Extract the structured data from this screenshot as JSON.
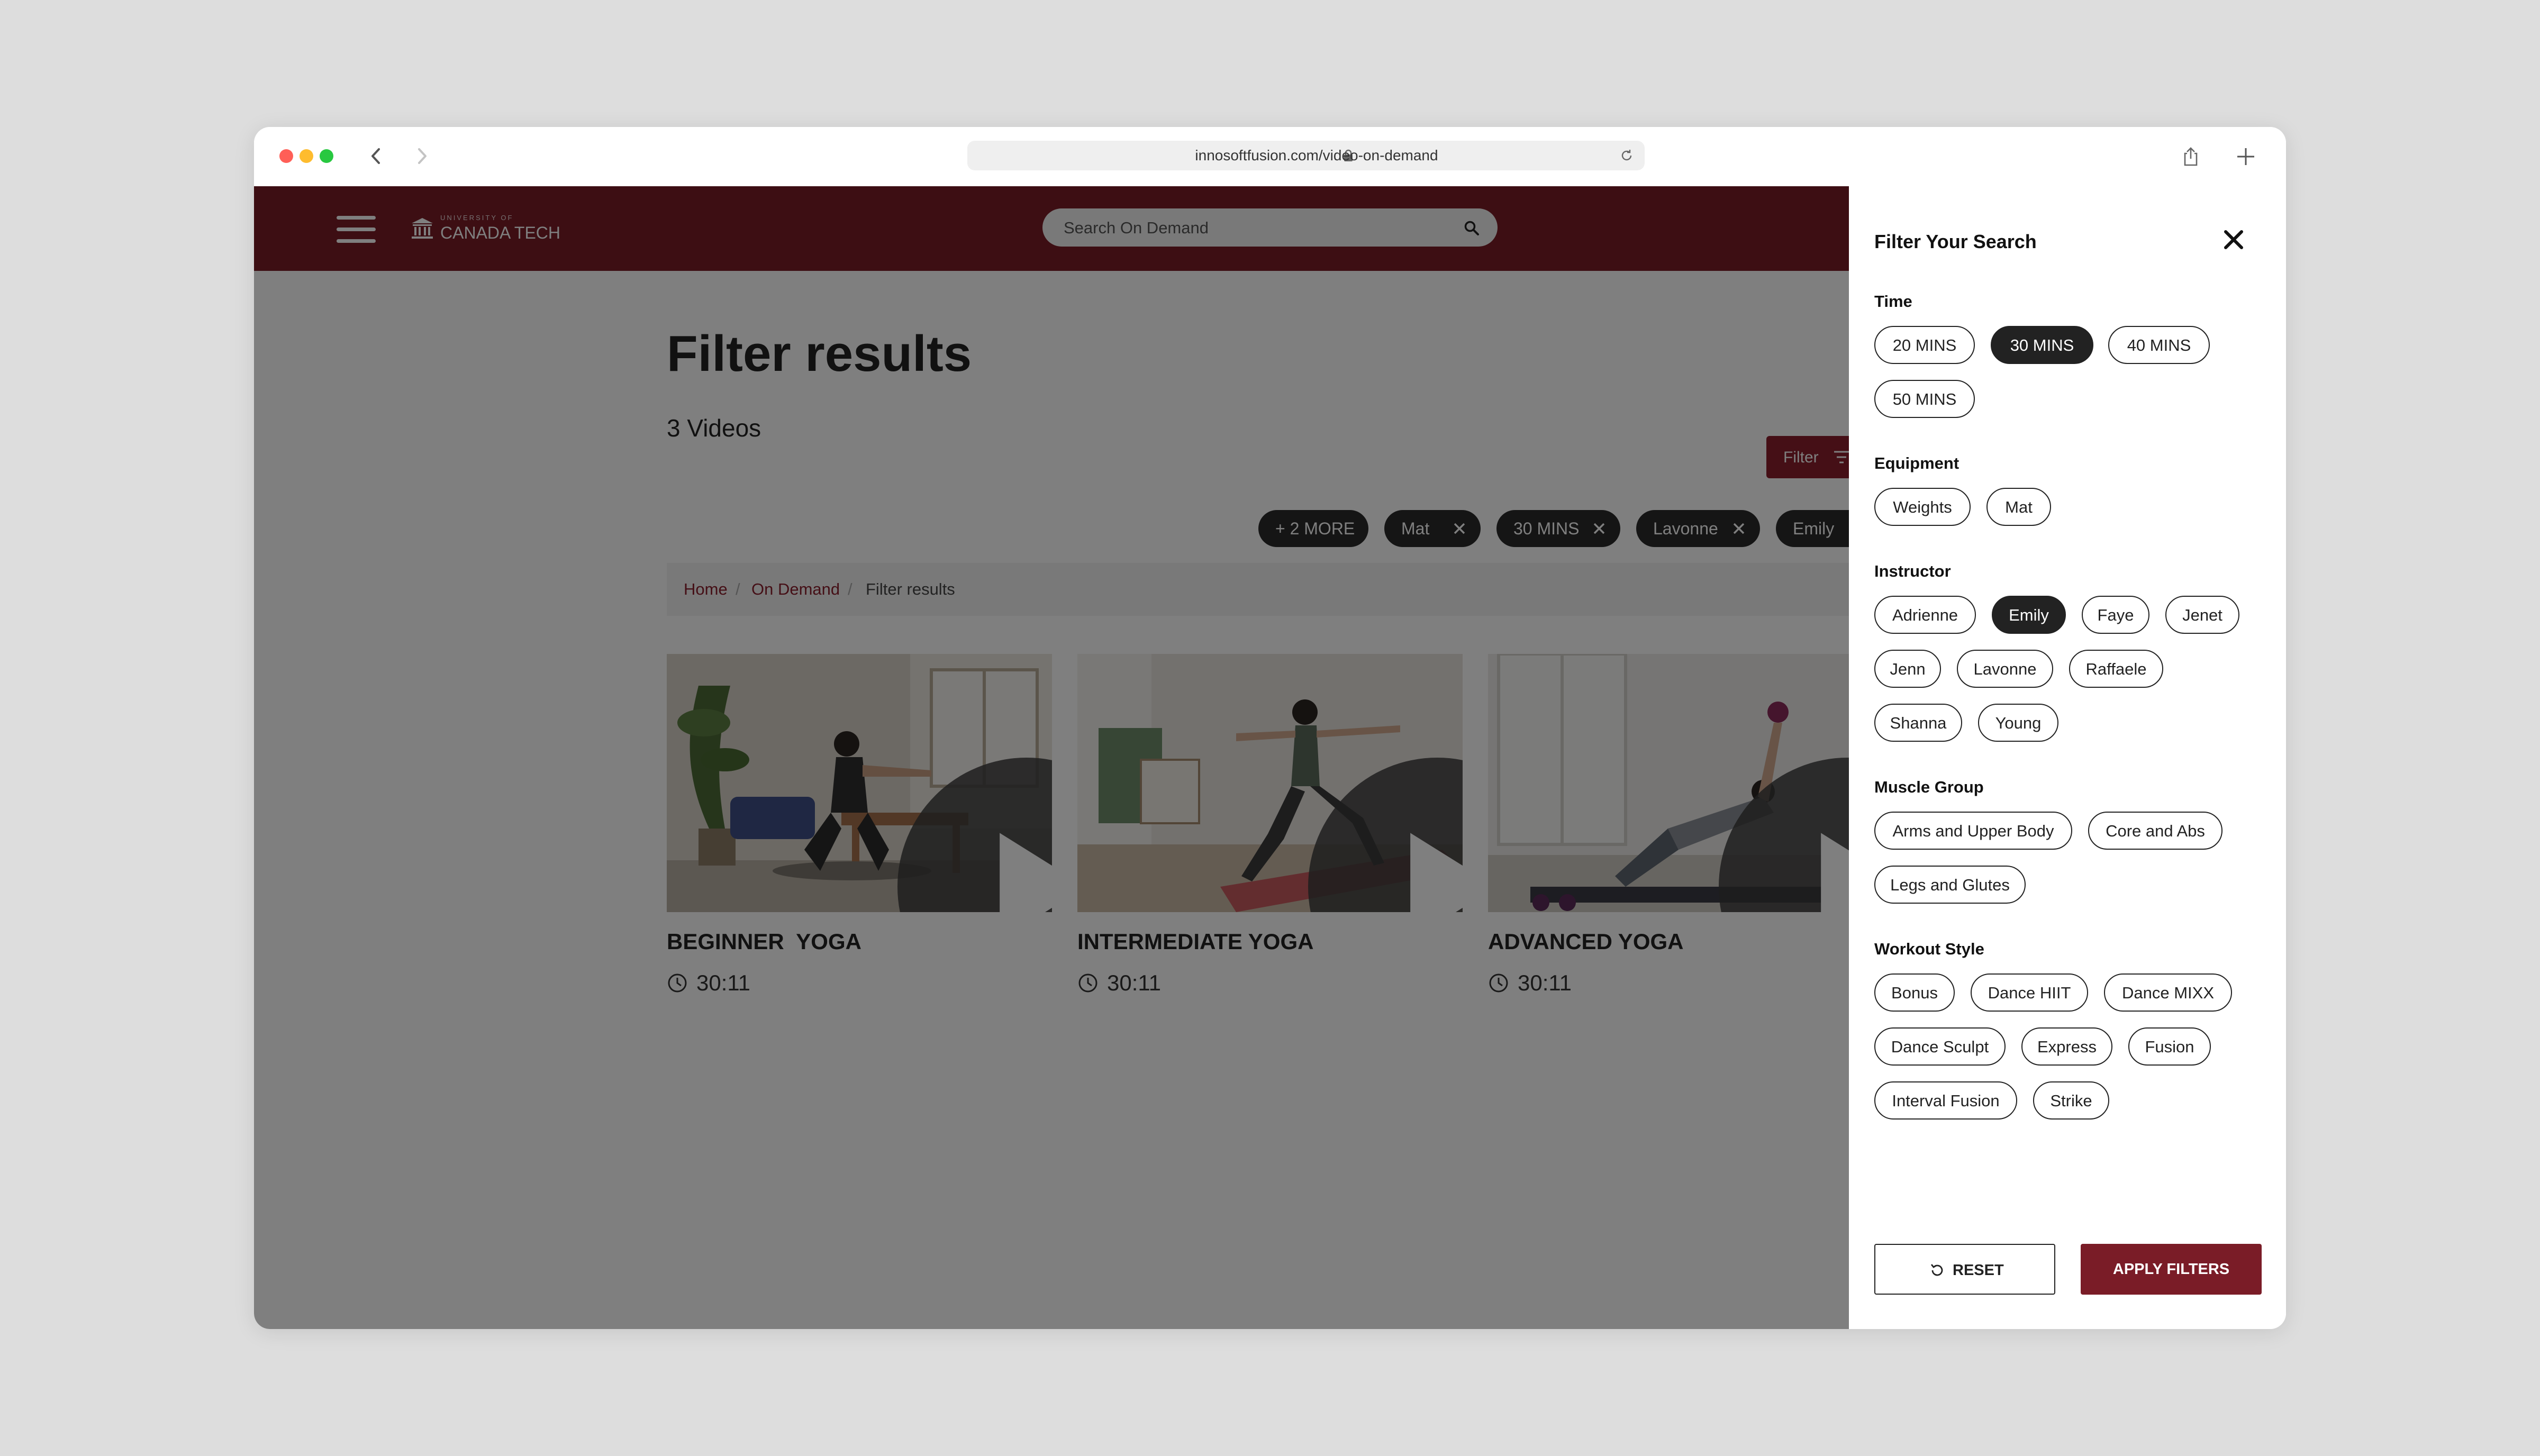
{
  "browser": {
    "url": "innosoftfusion.com/video-on-demand"
  },
  "site": {
    "logo_small": "UNIVERSITY OF",
    "logo_big": "CANADA TECH",
    "search_placeholder": "Search On Demand",
    "header_color": "#7a1c27"
  },
  "main": {
    "title": "Filter results",
    "video_count": "3 Videos",
    "filter_button": "Filter",
    "active_filters": [
      "+ 2 MORE",
      "Mat",
      "30 MINS",
      "Lavonne",
      "Emily"
    ],
    "breadcrumb": [
      "Home",
      "On Demand",
      "Filter results"
    ],
    "videos": [
      {
        "title": "BEGINNER  YOGA",
        "duration": "30:11"
      },
      {
        "title": "INTERMEDIATE YOGA",
        "duration": "30:11"
      },
      {
        "title": "ADVANCED YOGA",
        "duration": "30:11"
      }
    ]
  },
  "panel": {
    "title": "Filter Your Search",
    "sections": {
      "time": {
        "label": "Time",
        "options": [
          "20 MINS",
          "30 MINS",
          "40 MINS",
          "50 MINS"
        ],
        "selected": [
          "30 MINS"
        ]
      },
      "equipment": {
        "label": "Equipment",
        "options": [
          "Weights",
          "Mat"
        ],
        "selected": []
      },
      "instructor": {
        "label": "Instructor",
        "options": [
          "Adrienne",
          "Emily",
          "Faye",
          "Jenet",
          "Jenn",
          "Lavonne",
          "Raffaele",
          "Shanna",
          "Young"
        ],
        "selected": [
          "Emily"
        ]
      },
      "muscle": {
        "label": "Muscle Group",
        "options": [
          "Arms and Upper Body",
          "Core and Abs",
          "Legs and Glutes"
        ],
        "selected": []
      },
      "workout": {
        "label": "Workout Style",
        "options": [
          "Bonus",
          "Dance HIIT",
          "Dance MIXX",
          "Dance Sculpt",
          "Express",
          "Fusion",
          "Interval Fusion",
          "Strike"
        ],
        "selected": []
      }
    },
    "reset_label": "RESET",
    "apply_label": "APPLY FILTERS",
    "accent_color": "#7a1c27"
  }
}
